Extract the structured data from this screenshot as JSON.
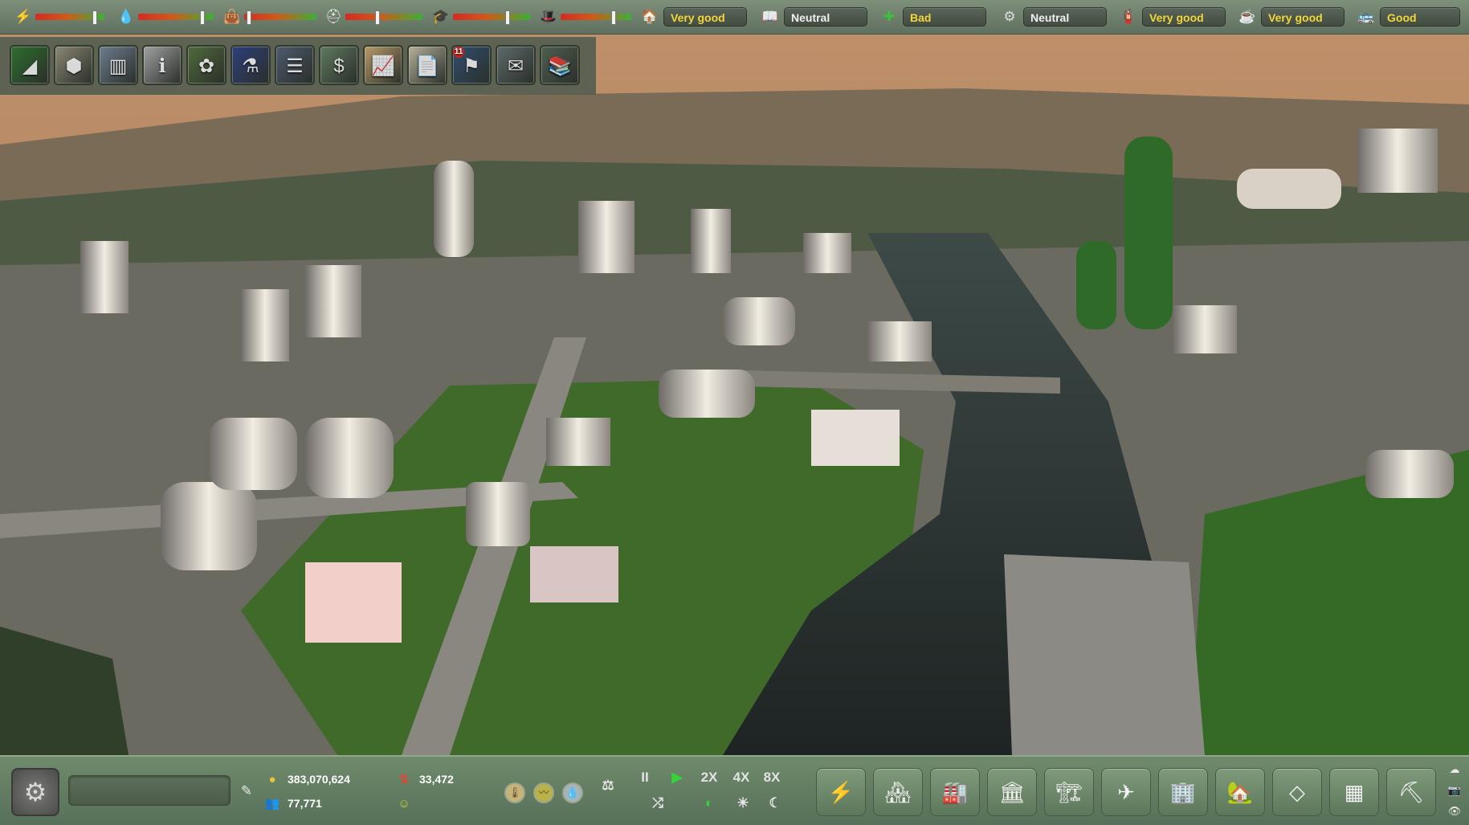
{
  "top_bar": {
    "meters": [
      {
        "icon": "lightning-icon",
        "glyph": "⚡",
        "level": 0.85
      },
      {
        "icon": "water-drop-icon",
        "glyph": "💧",
        "level": 0.84
      },
      {
        "icon": "waste-bag-icon",
        "glyph": "👜",
        "level": 0.06
      },
      {
        "icon": "worker-helmet-icon",
        "glyph": "⛑",
        "level": 0.41
      },
      {
        "icon": "education-icon",
        "glyph": "🎓",
        "level": 0.7
      },
      {
        "icon": "police-hat-icon",
        "glyph": "🎩",
        "level": 0.74
      }
    ],
    "ratings": [
      {
        "icon": "housing-icon",
        "glyph": "🏠",
        "value": "Very good",
        "tone": "good"
      },
      {
        "icon": "culture-icon",
        "glyph": "📖",
        "value": "Neutral",
        "tone": "neutral"
      },
      {
        "icon": "health-cross-icon",
        "glyph": "✚",
        "value": "Bad",
        "tone": "bad"
      },
      {
        "icon": "security-icon",
        "glyph": "⚙",
        "value": "Neutral",
        "tone": "neutral"
      },
      {
        "icon": "fire-safety-icon",
        "glyph": "🧯",
        "value": "Very good",
        "tone": "good"
      },
      {
        "icon": "leisure-icon",
        "glyph": "☕",
        "value": "Very good",
        "tone": "good"
      },
      {
        "icon": "transport-icon",
        "glyph": "🚌",
        "value": "Good",
        "tone": "good"
      }
    ]
  },
  "tool_palette": [
    {
      "name": "terrain-tool-icon",
      "glyph": "◢",
      "bg": "#2d6e2e"
    },
    {
      "name": "zoning-tool-icon",
      "glyph": "⬢",
      "bg": "#8a8774"
    },
    {
      "name": "statistics-tool-icon",
      "glyph": "▥",
      "bg": "#6d7d8f"
    },
    {
      "name": "info-tool-icon",
      "glyph": "ℹ",
      "bg": "#9fa2a2"
    },
    {
      "name": "resources-tool-icon",
      "glyph": "✿",
      "bg": "#4f6b3c"
    },
    {
      "name": "research-tool-icon",
      "glyph": "⚗",
      "bg": "#2d3f7a"
    },
    {
      "name": "roads-tool-icon",
      "glyph": "☰",
      "bg": "#4d5a6e"
    },
    {
      "name": "budget-tool-icon",
      "glyph": "$",
      "bg": "#5f7a5f"
    },
    {
      "name": "graph-tool-icon",
      "glyph": "📈",
      "bg": "#b89c6a"
    },
    {
      "name": "documents-tool-icon",
      "glyph": "📄",
      "bg": "#b5b09a"
    },
    {
      "name": "alerts-tool-icon",
      "glyph": "⚑",
      "bg": "#2f4f6f",
      "badge": "11"
    },
    {
      "name": "mail-tool-icon",
      "glyph": "✉",
      "bg": "#5d6a6a"
    },
    {
      "name": "library-tool-icon",
      "glyph": "📚",
      "bg": "#4f5f4f"
    }
  ],
  "bottom_bar": {
    "money": "383,070,624",
    "population": "77,771",
    "growth": "33,472",
    "speeds": {
      "pause": "II",
      "play": "▶",
      "x2": "2X",
      "x4": "4X",
      "x8": "8X"
    },
    "build_categories": [
      {
        "name": "power-build-icon",
        "glyph": "⚡"
      },
      {
        "name": "residential-build-icon",
        "glyph": "🏘"
      },
      {
        "name": "industry-build-icon",
        "glyph": "🏭"
      },
      {
        "name": "services-build-icon",
        "glyph": "🏛"
      },
      {
        "name": "factory-build-icon",
        "glyph": "🏗"
      },
      {
        "name": "airport-build-icon",
        "glyph": "✈"
      },
      {
        "name": "civic-build-icon",
        "glyph": "🏢"
      },
      {
        "name": "agriculture-build-icon",
        "glyph": "🏡"
      },
      {
        "name": "greenhouse-build-icon",
        "glyph": "◇"
      },
      {
        "name": "storage-build-icon",
        "glyph": "▦"
      },
      {
        "name": "demolish-build-icon",
        "glyph": "⛏"
      }
    ]
  }
}
